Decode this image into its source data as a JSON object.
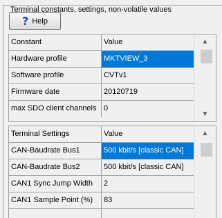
{
  "group": {
    "title": "Terminal constants, settings, non-volatile values"
  },
  "help_button": {
    "label": "Help"
  },
  "constants_table": {
    "headers": [
      "Constant",
      "Value"
    ],
    "rows": [
      {
        "name": "Hardware profile",
        "value": "MKTVIEW_3",
        "selected": true
      },
      {
        "name": "Software profile",
        "value": "CVTv1"
      },
      {
        "name": "Firmware date",
        "value": "20120719"
      },
      {
        "name": "max SDO client channels",
        "value": "0"
      }
    ]
  },
  "settings_table": {
    "headers": [
      "Terminal Settings",
      "Value"
    ],
    "rows": [
      {
        "name": "CAN-Baudrate Bus1",
        "value": "500 kbit/s [classic CAN]",
        "selected": true
      },
      {
        "name": "CAN-Baudrate Bus2",
        "value": "500 kbit/s [classic CAN]"
      },
      {
        "name": "CAN1 Sync Jump Width",
        "value": "2"
      },
      {
        "name": "CAN1 Sample Point (%)",
        "value": "83"
      },
      {
        "name": "",
        "value": ""
      }
    ]
  },
  "icons": {
    "help": "question-mark-icon",
    "scroll_up": "chevron-up-icon",
    "scroll_down": "chevron-down-icon"
  }
}
